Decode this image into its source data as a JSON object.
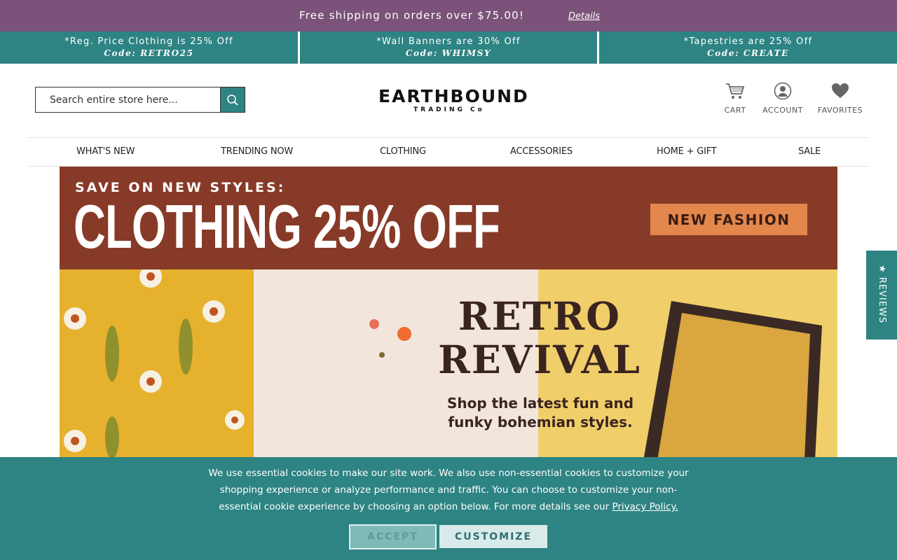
{
  "topbar": {
    "message": "Free shipping on orders over $75.00!",
    "details_link": "Details"
  },
  "promos": [
    {
      "line1": "*Reg. Price Clothing is 25% Off",
      "line2": "Code: RETRO25"
    },
    {
      "line1": "*Wall Banners are 30% Off",
      "line2": "Code: WHIMSY"
    },
    {
      "line1": "*Tapestries are 25% Off",
      "line2": "Code: CREATE"
    }
  ],
  "header": {
    "search_placeholder": "Search entire store here...",
    "logo_main": "EARTHBOUND",
    "logo_sub": "TRADING Co",
    "icons": [
      {
        "label": "CART",
        "icon": "cart-icon"
      },
      {
        "label": "ACCOUNT",
        "icon": "user-icon"
      },
      {
        "label": "FAVORITES",
        "icon": "heart-icon"
      }
    ]
  },
  "nav": [
    "WHAT'S NEW",
    "TRENDING NOW",
    "CLOTHING",
    "ACCESSORIES",
    "HOME + GIFT",
    "SALE"
  ],
  "hero": {
    "eyebrow": "SAVE ON NEW STYLES:",
    "headline": "CLOTHING 25% OFF",
    "cta": "NEW FASHION",
    "retro_line1": "RETRO",
    "retro_line2": "REVIVAL",
    "subtext_line1": "Shop the latest fun and",
    "subtext_line2": "funky bohemian styles."
  },
  "reviews_tab": "★ REVIEWS",
  "cookie": {
    "text": "We use essential cookies to make our site work. We also use non-essential cookies to customize your shopping experience or analyze performance and traffic. You can choose to customize your non-essential cookie experience by choosing an option below. For more details see our",
    "link": "Privacy Policy.",
    "accept": "ACCEPT",
    "customize": "CUSTOMIZE"
  },
  "colors": {
    "topbar": "#7b5279",
    "teal": "#2e8383",
    "hero_brown": "#873a27",
    "cta_orange": "#e3874d"
  }
}
